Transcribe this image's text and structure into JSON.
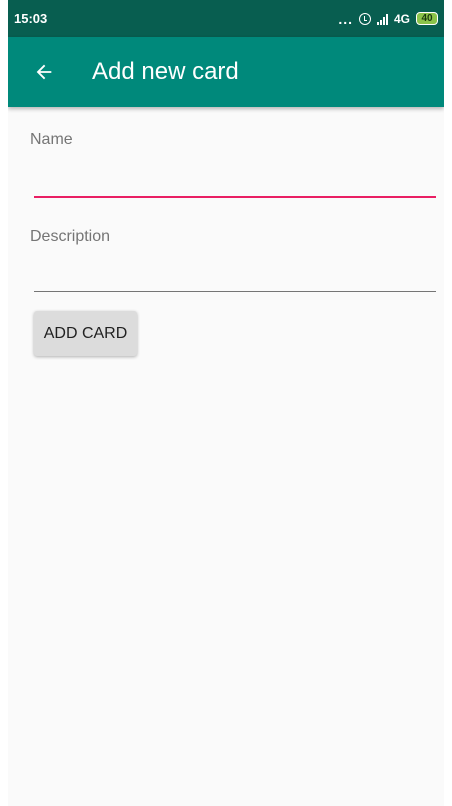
{
  "status_bar": {
    "time": "15:03",
    "dots": "...",
    "network": "4G",
    "battery": "40",
    "alarm_icon": "alarm-icon",
    "signal_icon": "signal-icon",
    "battery_icon": "battery-icon"
  },
  "app_bar": {
    "back_icon": "arrow-back-icon",
    "title": "Add new card",
    "color": "#00897b"
  },
  "form": {
    "name_label": "Name",
    "name_value": "",
    "description_label": "Description",
    "description_value": "",
    "focused_underline_color": "#e91e63",
    "underline_color": "#757575"
  },
  "add_card_button": {
    "label": "ADD CARD"
  }
}
